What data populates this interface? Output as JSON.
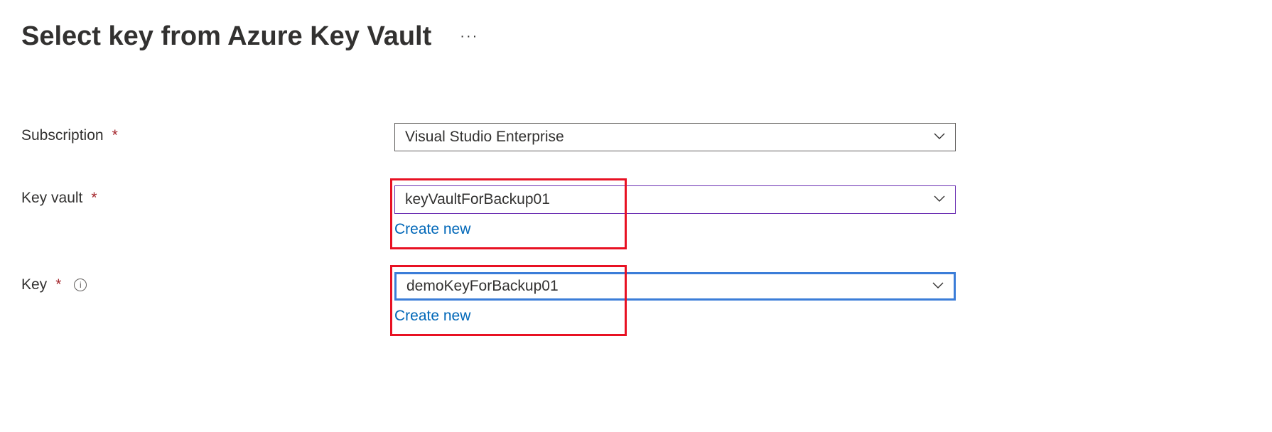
{
  "header": {
    "title": "Select key from Azure Key Vault"
  },
  "form": {
    "subscription": {
      "label": "Subscription",
      "value": "Visual Studio Enterprise"
    },
    "keyvault": {
      "label": "Key vault",
      "value": "keyVaultForBackup01",
      "create_link": "Create new"
    },
    "key": {
      "label": "Key",
      "value": "demoKeyForBackup01",
      "create_link": "Create new"
    }
  }
}
